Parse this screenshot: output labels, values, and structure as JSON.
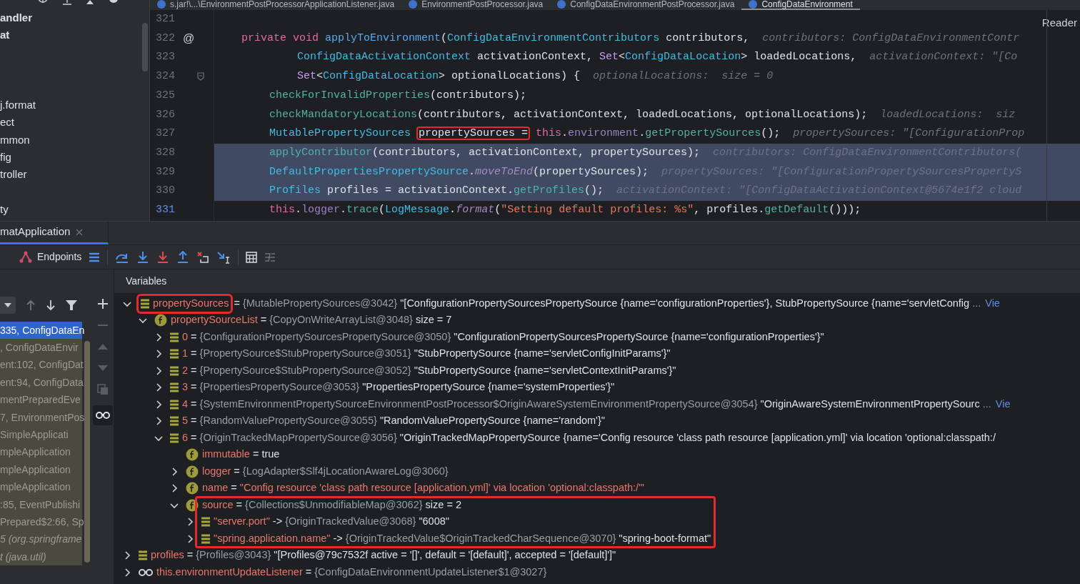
{
  "project_panel": {
    "items": [
      {
        "kind": "entry",
        "text": "andler",
        "bold": true
      },
      {
        "kind": "entry",
        "text": "at",
        "bold": true
      },
      {
        "kind": "blank"
      },
      {
        "kind": "blank"
      },
      {
        "kind": "blank"
      },
      {
        "kind": "entry",
        "text": "j.format",
        "bold": false
      },
      {
        "kind": "entry",
        "text": "ect",
        "bold": false
      },
      {
        "kind": "entry",
        "text": "mmon",
        "bold": false
      },
      {
        "kind": "entry",
        "text": "fig",
        "bold": false
      },
      {
        "kind": "entry",
        "text": "troller",
        "bold": false
      },
      {
        "kind": "blank"
      },
      {
        "kind": "entry",
        "text": "ty",
        "bold": false
      }
    ]
  },
  "editor": {
    "tabs": [
      {
        "label": "s.jar!\\...\\EnvironmentPostProcessorApplicationListener.java",
        "selected": false
      },
      {
        "label": "EnvironmentPostProcessor.java",
        "selected": false
      },
      {
        "label": "ConfigDataEnvironmentPostProcessor.java",
        "selected": false
      },
      {
        "label": "ConfigDataEnvironment",
        "selected": true
      }
    ],
    "reader_mode": "Reader",
    "lines": [
      {
        "number": "321",
        "kind": "blank",
        "selected": false,
        "current": false,
        "fold": false
      },
      {
        "number": "322",
        "kind": "signature",
        "selected": false,
        "current": false,
        "fold": false,
        "marker": "@",
        "tokens": [
          {
            "kind": "kw",
            "text": "private void "
          },
          {
            "kind": "decl",
            "text": "applyToEnvironment"
          },
          {
            "kind": "txt",
            "text": "("
          },
          {
            "kind": "type",
            "text": "ConfigDataEnvironmentContributors"
          },
          {
            "kind": "txt",
            "text": " contributors,"
          }
        ],
        "hint": "contributors: ConfigDataEnvironmentContr"
      },
      {
        "number": "323",
        "kind": "continuation",
        "selected": false,
        "current": false,
        "fold": false,
        "tokens": [
          {
            "kind": "type",
            "text": "ConfigDataActivationContext"
          },
          {
            "kind": "txt",
            "text": " activationContext, "
          },
          {
            "kind": "iface",
            "text": "Set"
          },
          {
            "kind": "txt",
            "text": "<"
          },
          {
            "kind": "type",
            "text": "ConfigDataLocation"
          },
          {
            "kind": "txt",
            "text": "> loadedLocations,"
          }
        ],
        "hint": "activationContext: \"[Co"
      },
      {
        "number": "324",
        "kind": "continuation",
        "selected": false,
        "current": false,
        "fold": true,
        "tokens": [
          {
            "kind": "iface",
            "text": "Set"
          },
          {
            "kind": "txt",
            "text": "<"
          },
          {
            "kind": "type",
            "text": "ConfigDataLocation"
          },
          {
            "kind": "txt",
            "text": "> optionalLocations) {"
          }
        ],
        "hint": "optionalLocations:  size = 0"
      },
      {
        "number": "325",
        "kind": "body",
        "selected": false,
        "current": false,
        "fold": false,
        "tokens": [
          {
            "kind": "call",
            "text": "checkForInvalidProperties"
          },
          {
            "kind": "txt",
            "text": "(contributors);"
          }
        ]
      },
      {
        "number": "326",
        "kind": "body",
        "selected": false,
        "current": false,
        "fold": false,
        "tokens": [
          {
            "kind": "call",
            "text": "checkMandatoryLocations"
          },
          {
            "kind": "txt",
            "text": "(contributors, activationContext, loadedLocations, optionalLocations);"
          }
        ],
        "hint": "loadedLocations:  siz"
      },
      {
        "number": "327",
        "kind": "body",
        "selected": false,
        "current": false,
        "fold": false,
        "tokens": [
          {
            "kind": "type",
            "text": "MutablePropertySources"
          },
          {
            "kind": "boxed",
            "text": "propertySources ="
          },
          {
            "kind": "kw",
            "text": "this"
          },
          {
            "kind": "txt",
            "text": "."
          },
          {
            "kind": "field",
            "text": "environment"
          },
          {
            "kind": "txt",
            "text": "."
          },
          {
            "kind": "call",
            "text": "getPropertySources"
          },
          {
            "kind": "txt",
            "text": "();"
          }
        ],
        "hint": "propertySources: \"[ConfigurationProp"
      },
      {
        "number": "328",
        "kind": "body",
        "selected": true,
        "current": false,
        "fold": false,
        "tokens": [
          {
            "kind": "call",
            "text": "applyContributor"
          },
          {
            "kind": "txt",
            "text": "(contributors, activationContext, propertySources);"
          }
        ],
        "hint": "contributors: ConfigDataEnvironmentContributors("
      },
      {
        "number": "329",
        "kind": "body",
        "selected": true,
        "current": false,
        "fold": false,
        "tokens": [
          {
            "kind": "type",
            "text": "DefaultPropertiesPropertySource"
          },
          {
            "kind": "txt",
            "text": "."
          },
          {
            "kind": "static",
            "text": "moveToEnd"
          },
          {
            "kind": "txt",
            "text": "(propertySources);"
          }
        ],
        "hint": "propertySources: \"[ConfigurationPropertySourcesPropertyS"
      },
      {
        "number": "330",
        "kind": "body",
        "selected": true,
        "current": false,
        "fold": false,
        "tokens": [
          {
            "kind": "type",
            "text": "Profiles"
          },
          {
            "kind": "txt",
            "text": " profiles = activationContext."
          },
          {
            "kind": "call",
            "text": "getProfiles"
          },
          {
            "kind": "txt",
            "text": "();"
          }
        ],
        "hint": "activationContext: \"[ConfigDataActivationContext@5674e1f2 cloud"
      },
      {
        "number": "331",
        "kind": "body",
        "selected": false,
        "current": true,
        "fold": false,
        "tokens": [
          {
            "kind": "kw",
            "text": "this"
          },
          {
            "kind": "txt",
            "text": "."
          },
          {
            "kind": "field",
            "text": "logger"
          },
          {
            "kind": "txt",
            "text": "."
          },
          {
            "kind": "call",
            "text": "trace"
          },
          {
            "kind": "txt",
            "text": "("
          },
          {
            "kind": "type",
            "text": "LogMessage"
          },
          {
            "kind": "txt",
            "text": "."
          },
          {
            "kind": "static",
            "text": "format"
          },
          {
            "kind": "txt",
            "text": "("
          },
          {
            "kind": "str",
            "text": "\"Setting default profiles: %s\""
          },
          {
            "kind": "txt",
            "text": ", profiles."
          },
          {
            "kind": "call",
            "text": "getDefault"
          },
          {
            "kind": "txt",
            "text": "()));"
          }
        ]
      }
    ]
  },
  "debug": {
    "tabs": [
      {
        "label": "matApplication",
        "selected": true
      }
    ],
    "endpoints": "Endpoints",
    "frames": [
      {
        "text": "335, ConfigDataEn",
        "selected": true,
        "kind": "frame"
      },
      {
        "text": ", ConfigDataEnvir",
        "selected": false,
        "kind": "frame"
      },
      {
        "text": "ent:102, ConfigDat",
        "selected": false,
        "kind": "frame"
      },
      {
        "text": "ent:94, ConfigData",
        "selected": false,
        "kind": "frame"
      },
      {
        "text": "mentPreparedEve",
        "selected": false,
        "kind": "frame"
      },
      {
        "text": "7, EnvironmentPos",
        "selected": false,
        "kind": "frame"
      },
      {
        "text": "SimpleApplicati",
        "selected": false,
        "kind": "frame"
      },
      {
        "text": "mpleApplication",
        "selected": false,
        "kind": "frame"
      },
      {
        "text": "mpleApplication",
        "selected": false,
        "kind": "frame"
      },
      {
        "text": "mpleApplication",
        "selected": false,
        "kind": "frame"
      },
      {
        "text": ":85, EventPublishi",
        "selected": false,
        "kind": "frame"
      },
      {
        "text": "Prepared$2:66, Sp",
        "selected": false,
        "kind": "frame"
      },
      {
        "text": "5 (org.springframe",
        "selected": false,
        "kind": "async"
      },
      {
        "text": "t (java.util)",
        "selected": false,
        "kind": "async"
      }
    ],
    "variables": {
      "title": "Variables",
      "tree": [
        {
          "kind": "list",
          "name": "propertySources",
          "sep": " = ",
          "ref": "{MutablePropertySources@3042}",
          "value": "\"[ConfigurationPropertySourcesPropertySource {name='configurationProperties'}, StubPropertySource {name='servletConfig",
          "string_literal": false,
          "more": "...",
          "link": "Vie",
          "highlighted": true,
          "expanded": true,
          "children": [
            {
              "kind": "field",
              "name": "propertySourceList",
              "sep": " = ",
              "ref": "{CopyOnWriteArrayList@3048}",
              "value": "size = 7",
              "string_literal": false,
              "highlighted": false,
              "expanded": true,
              "children": [
                {
                  "kind": "list",
                  "name": "0",
                  "sep": " = ",
                  "ref": "{ConfigurationPropertySourcesPropertySource@3050}",
                  "value": "\"ConfigurationPropertySourcesPropertySource {name='configurationProperties'}\"",
                  "string_literal": false,
                  "highlighted": false,
                  "expanded": false
                },
                {
                  "kind": "list",
                  "name": "1",
                  "sep": " = ",
                  "ref": "{PropertySource$StubPropertySource@3051}",
                  "value": "\"StubPropertySource {name='servletConfigInitParams'}\"",
                  "string_literal": false,
                  "highlighted": false,
                  "expanded": false
                },
                {
                  "kind": "list",
                  "name": "2",
                  "sep": " = ",
                  "ref": "{PropertySource$StubPropertySource@3052}",
                  "value": "\"StubPropertySource {name='servletContextInitParams'}\"",
                  "string_literal": false,
                  "highlighted": false,
                  "expanded": false
                },
                {
                  "kind": "list",
                  "name": "3",
                  "sep": " = ",
                  "ref": "{PropertiesPropertySource@3053}",
                  "value": "\"PropertiesPropertySource {name='systemProperties'}\"",
                  "string_literal": false,
                  "highlighted": false,
                  "expanded": false
                },
                {
                  "kind": "list",
                  "name": "4",
                  "sep": " = ",
                  "ref": "{SystemEnvironmentPropertySourceEnvironmentPostProcessor$OriginAwareSystemEnvironmentPropertySource@3054}",
                  "value": "\"OriginAwareSystemEnvironmentPropertySourc",
                  "string_literal": false,
                  "more": "...",
                  "link": "Vie",
                  "highlighted": false,
                  "expanded": false
                },
                {
                  "kind": "list",
                  "name": "5",
                  "sep": " = ",
                  "ref": "{RandomValuePropertySource@3055}",
                  "value": "\"RandomValuePropertySource {name='random'}\"",
                  "string_literal": false,
                  "highlighted": false,
                  "expanded": false
                },
                {
                  "kind": "list",
                  "name": "6",
                  "sep": " = ",
                  "ref": "{OriginTrackedMapPropertySource@3056}",
                  "value": "\"OriginTrackedMapPropertySource {name='Config resource 'class path resource [application.yml]' via location 'optional:classpath:/",
                  "string_literal": false,
                  "highlighted": false,
                  "expanded": true,
                  "children": [
                    {
                      "kind": "field",
                      "name": "immutable",
                      "sep": " = ",
                      "value": "true",
                      "string_literal": false,
                      "highlighted": false
                    },
                    {
                      "kind": "field",
                      "name": "logger",
                      "sep": " = ",
                      "ref": "{LogAdapter$Slf4jLocationAwareLog@3060}",
                      "highlighted": false,
                      "expanded": false
                    },
                    {
                      "kind": "field",
                      "name": "name",
                      "sep": " = ",
                      "value": "\"Config resource 'class path resource [application.yml]' via location 'optional:classpath:/'\"",
                      "string_literal": true,
                      "highlighted": false,
                      "expanded": false
                    },
                    {
                      "kind": "field",
                      "name": "source",
                      "sep": " = ",
                      "ref": "{Collections$UnmodifiableMap@3062}",
                      "value": "size = 2",
                      "string_literal": false,
                      "highlighted": true,
                      "expanded": true,
                      "children": [
                        {
                          "kind": "list",
                          "name": "\"server.port\"",
                          "sep": " -> ",
                          "ref": "{OriginTrackedValue@3068}",
                          "value": "\"6008\"",
                          "string_literal": false,
                          "highlighted": false,
                          "expanded": false
                        },
                        {
                          "kind": "list",
                          "name": "\"spring.application.name\"",
                          "sep": " -> ",
                          "ref": "{OriginTrackedValue$OriginTrackedCharSequence@3070}",
                          "value": "\"spring-boot-format\"",
                          "string_literal": false,
                          "highlighted": false,
                          "expanded": false
                        }
                      ]
                    }
                  ]
                }
              ]
            }
          ]
        },
        {
          "kind": "list",
          "name": "profiles",
          "sep": " = ",
          "ref": "{Profiles@3043}",
          "value": "\"[Profiles@79c7532f active = '[]', default = '[default]', accepted = '[default]']\"",
          "string_literal": false,
          "highlighted": false,
          "expanded": false
        },
        {
          "kind": "watch",
          "name": "this.environmentUpdateListener",
          "sep": " = ",
          "ref": "{ConfigDataEnvironmentUpdateListener$1@3027}",
          "highlighted": false,
          "expanded": false
        }
      ]
    }
  }
}
